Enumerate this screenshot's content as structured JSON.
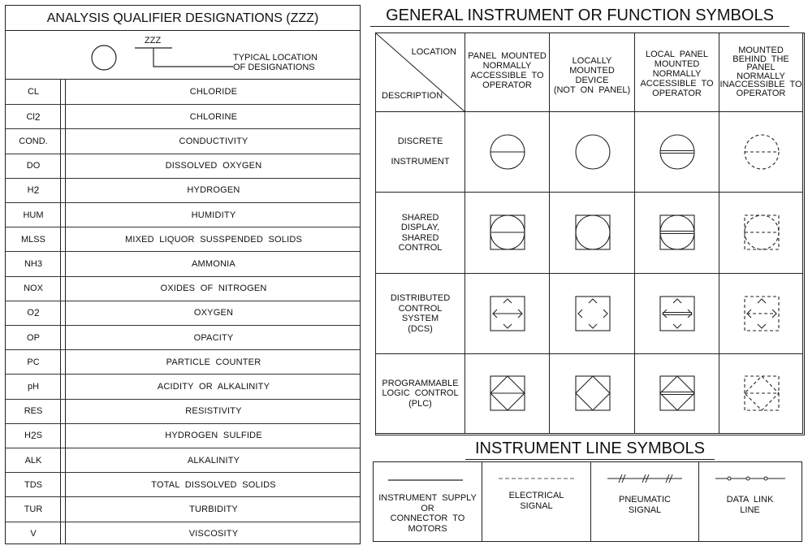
{
  "analysis_table": {
    "title": "ANALYSIS QUALIFIER DESIGNATIONS (ZZZ)",
    "diagram": {
      "tag_label": "ZZZ",
      "note_line1": "TYPICAL  LOCATION",
      "note_line2": "OF  DESIGNATIONS"
    },
    "rows": [
      {
        "code": "CL",
        "code_sub": "",
        "code_tail": "",
        "description": "CHLORIDE"
      },
      {
        "code": "Cl",
        "code_sub": "2",
        "code_tail": "",
        "description": "CHLORINE"
      },
      {
        "code": "COND.",
        "code_sub": "",
        "code_tail": "",
        "description": "CONDUCTIVITY"
      },
      {
        "code": "DO",
        "code_sub": "",
        "code_tail": "",
        "description": "DISSOLVED  OXYGEN"
      },
      {
        "code": "H",
        "code_sub": "2",
        "code_tail": "",
        "description": "HYDROGEN"
      },
      {
        "code": "HUM",
        "code_sub": "",
        "code_tail": "",
        "description": "HUMIDITY"
      },
      {
        "code": "MLSS",
        "code_sub": "",
        "code_tail": "",
        "description": "MIXED  LIQUOR  SUSSPENDED  SOLIDS"
      },
      {
        "code": "NH3",
        "code_sub": "",
        "code_tail": "",
        "description": "AMMONIA"
      },
      {
        "code": "NOX",
        "code_sub": "",
        "code_tail": "",
        "description": "OXIDES  OF  NITROGEN"
      },
      {
        "code": "O",
        "code_sub": "2",
        "code_tail": "",
        "description": "OXYGEN"
      },
      {
        "code": "OP",
        "code_sub": "",
        "code_tail": "",
        "description": "OPACITY"
      },
      {
        "code": "PC",
        "code_sub": "",
        "code_tail": "",
        "description": "PARTICLE  COUNTER"
      },
      {
        "code": "pH",
        "code_sub": "",
        "code_tail": "",
        "description": "ACIDITY  OR  ALKALINITY"
      },
      {
        "code": "RES",
        "code_sub": "",
        "code_tail": "",
        "description": "RESISTIVITY"
      },
      {
        "code": "H",
        "code_sub": "2",
        "code_tail": "S",
        "description": "HYDROGEN  SULFIDE"
      },
      {
        "code": "ALK",
        "code_sub": "",
        "code_tail": "",
        "description": "ALKALINITY"
      },
      {
        "code": "TDS",
        "code_sub": "",
        "code_tail": "",
        "description": "TOTAL  DISSOLVED  SOLIDS"
      },
      {
        "code": "TUR",
        "code_sub": "",
        "code_tail": "",
        "description": "TURBIDITY"
      },
      {
        "code": "V",
        "code_sub": "",
        "code_tail": "",
        "description": "VISCOSITY"
      }
    ]
  },
  "function_symbols": {
    "title": "GENERAL INSTRUMENT OR FUNCTION SYMBOLS",
    "corner": {
      "top": "LOCATION",
      "bottom": "DESCRIPTION"
    },
    "columns": [
      {
        "lines": [
          "PANEL  MOUNTED",
          "NORMALLY",
          "ACCESSIBLE  TO",
          "OPERATOR"
        ],
        "style": "panel"
      },
      {
        "lines": [
          "LOCALLY",
          "MOUNTED",
          "DEVICE",
          "(NOT  ON  PANEL)"
        ],
        "style": "local"
      },
      {
        "lines": [
          "LOCAL  PANEL",
          "MOUNTED",
          "NORMALLY",
          "ACCESSIBLE  TO",
          "OPERATOR"
        ],
        "style": "local-panel"
      },
      {
        "lines": [
          "MOUNTED",
          "BEHIND  THE",
          "PANEL",
          "NORMALLY",
          "INACCESSIBLE  TO",
          "OPERATOR"
        ],
        "style": "behind-panel"
      }
    ],
    "rows": [
      {
        "lines": [
          "DISCRETE",
          "",
          "INSTRUMENT"
        ],
        "symbol": "circle"
      },
      {
        "lines": [
          "SHARED",
          "DISPLAY,",
          "SHARED",
          "CONTROL"
        ],
        "symbol": "circle-in-square"
      },
      {
        "lines": [
          "DISTRIBUTED",
          "CONTROL",
          "SYSTEM",
          "(DCS)"
        ],
        "symbol": "dcs"
      },
      {
        "lines": [
          "PROGRAMMABLE",
          "LOGIC  CONTROL",
          "(PLC)"
        ],
        "symbol": "diamond-in-square"
      }
    ]
  },
  "line_symbols": {
    "title": "INSTRUMENT LINE SYMBOLS",
    "items": [
      {
        "label_lines": [
          "INSTRUMENT  SUPPLY",
          "OR",
          "CONNECTOR  TO",
          "MOTORS"
        ],
        "line": "solid"
      },
      {
        "label_lines": [
          "ELECTRICAL",
          "SIGNAL"
        ],
        "line": "dashed"
      },
      {
        "label_lines": [
          "PNEUMATIC",
          "SIGNAL"
        ],
        "line": "hatched"
      },
      {
        "label_lines": [
          "DATA  LINK",
          "LINE"
        ],
        "line": "circles"
      }
    ]
  }
}
